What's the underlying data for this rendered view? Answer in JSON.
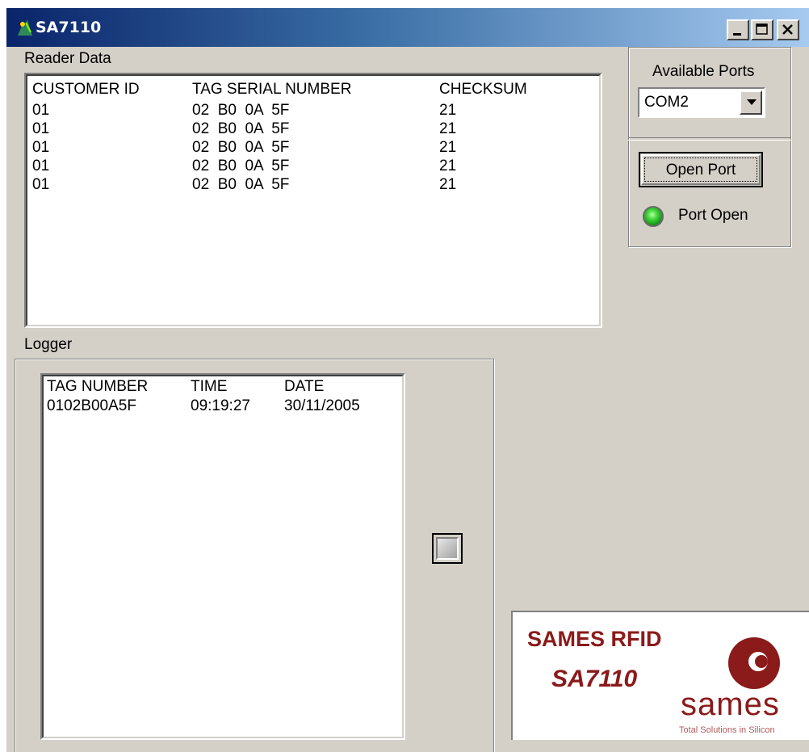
{
  "window": {
    "title": "SA7110"
  },
  "reader_data": {
    "label": "Reader Data",
    "columns": [
      "CUSTOMER ID",
      "TAG SERIAL NUMBER",
      "CHECKSUM"
    ],
    "rows": [
      [
        "01",
        "02  B0  0A  5F",
        "21"
      ],
      [
        "01",
        "02  B0  0A  5F",
        "21"
      ],
      [
        "01",
        "02  B0  0A  5F",
        "21"
      ],
      [
        "01",
        "02  B0  0A  5F",
        "21"
      ],
      [
        "01",
        "02  B0  0A  5F",
        "21"
      ]
    ]
  },
  "ports": {
    "label": "Available Ports",
    "selected": "COM2",
    "open_button": "Open Port",
    "status_label": "Port Open",
    "status_color": "#3fd43a"
  },
  "logger": {
    "label": "Logger",
    "columns": [
      "TAG NUMBER",
      "TIME",
      "DATE"
    ],
    "rows": [
      [
        "0102B00A5F",
        "09:19:27",
        "30/11/2005"
      ]
    ]
  },
  "logo": {
    "line1": "SAMES RFID",
    "line2": "SA7110",
    "brand": "sames",
    "tagline": "Total Solutions in Silicon",
    "color": "#8b1a1a"
  },
  "icons": {
    "app": "rfid-antenna-icon",
    "minimize": "minimize-icon",
    "maximize": "maximize-icon",
    "close": "close-icon",
    "dropdown": "chevron-down-icon",
    "status": "green-led-icon",
    "logo_mark": "sames-logo-icon"
  }
}
